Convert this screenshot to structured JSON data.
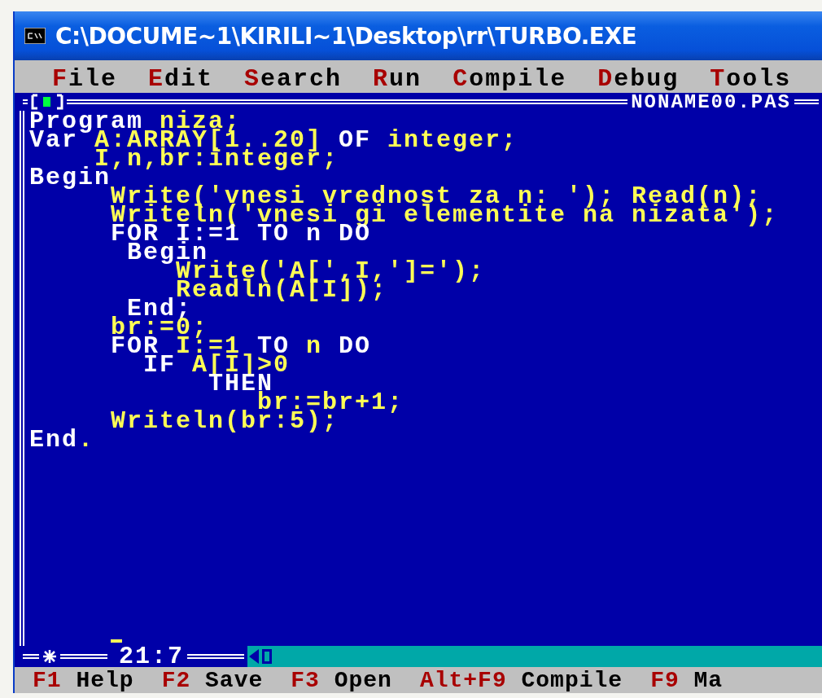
{
  "window": {
    "title": "C:\\DOCUME~1\\KIRILI~1\\Desktop\\rr\\TURBO.EXE"
  },
  "menu": [
    {
      "label": "File"
    },
    {
      "label": "Edit"
    },
    {
      "label": "Search"
    },
    {
      "label": "Run"
    },
    {
      "label": "Compile"
    },
    {
      "label": "Debug"
    },
    {
      "label": "Tools"
    }
  ],
  "editor": {
    "file_name": "NONAME00.PAS",
    "position": "21:7",
    "lines": [
      [
        {
          "kind": "keyword",
          "text": "Program"
        },
        {
          "kind": "other",
          "text": " niza;"
        }
      ],
      [
        {
          "kind": "keyword",
          "text": "Var"
        },
        {
          "kind": "other",
          "text": " A:ARRAY[1..20] "
        },
        {
          "kind": "keyword",
          "text": "OF"
        },
        {
          "kind": "other",
          "text": " integer;"
        }
      ],
      [
        {
          "kind": "other",
          "text": "    I,n,br:integer;"
        }
      ],
      [
        {
          "kind": "keyword",
          "text": "Begin"
        }
      ],
      [
        {
          "kind": "other",
          "text": "     Write('vnesi vrednost za n: '); Read(n);"
        }
      ],
      [
        {
          "kind": "other",
          "text": "     Writeln('vnesi gi elementite na nizata');"
        }
      ],
      [
        {
          "kind": "keyword",
          "text": "     FOR I:=1 TO n DO"
        }
      ],
      [
        {
          "kind": "keyword",
          "text": "      Begin"
        }
      ],
      [
        {
          "kind": "other",
          "text": "         Write('A[',I,']=');"
        }
      ],
      [
        {
          "kind": "other",
          "text": "         Readln(A[I]);"
        }
      ],
      [
        {
          "kind": "keyword",
          "text": "      End;"
        }
      ],
      [
        {
          "kind": "other",
          "text": "     br:=0;"
        }
      ],
      [
        {
          "kind": "keyword",
          "text": "     FOR "
        },
        {
          "kind": "other",
          "text": "I:=1"
        },
        {
          "kind": "keyword",
          "text": " TO "
        },
        {
          "kind": "other",
          "text": "n"
        },
        {
          "kind": "keyword",
          "text": " DO"
        }
      ],
      [
        {
          "kind": "keyword",
          "text": "       IF"
        },
        {
          "kind": "other",
          "text": " A[I]>0"
        }
      ],
      [
        {
          "kind": "keyword",
          "text": "           THEN"
        }
      ],
      [
        {
          "kind": "other",
          "text": "              br:=br+1;"
        }
      ],
      [
        {
          "kind": "other",
          "text": "     Writeln(br:5);"
        }
      ],
      [
        {
          "kind": "keyword",
          "text": "End"
        },
        {
          "kind": "other",
          "text": "."
        }
      ]
    ]
  },
  "status_bar": [
    {
      "key": "F1",
      "label": "Help"
    },
    {
      "key": "F2",
      "label": "Save"
    },
    {
      "key": "F3",
      "label": "Open"
    },
    {
      "key": "Alt+F9",
      "label": "Compile"
    },
    {
      "key": "F9",
      "label": "Ma"
    }
  ]
}
